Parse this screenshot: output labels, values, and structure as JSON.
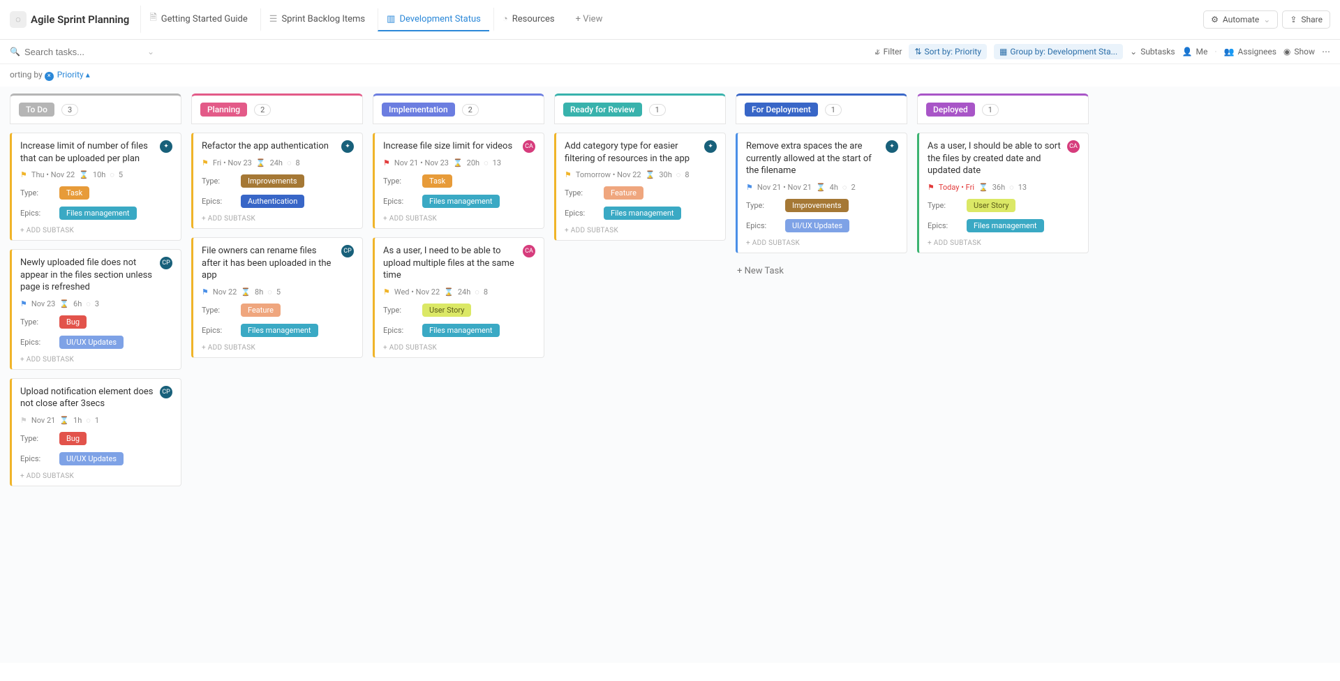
{
  "header": {
    "app_title": "Agile Sprint Planning",
    "tabs": [
      {
        "label": "Getting Started Guide",
        "active": false
      },
      {
        "label": "Sprint Backlog Items",
        "active": false
      },
      {
        "label": "Development Status",
        "active": true
      },
      {
        "label": "Resources",
        "active": false
      }
    ],
    "add_view": "+ View",
    "automate": "Automate",
    "share": "Share"
  },
  "toolbar": {
    "search_placeholder": "Search tasks...",
    "filter": "Filter",
    "sort": "Sort by: Priority",
    "group": "Group by: Development Sta...",
    "subtasks": "Subtasks",
    "me": "Me",
    "assignees": "Assignees",
    "show": "Show"
  },
  "sorting_row": {
    "prefix": "orting by",
    "value": "Priority"
  },
  "columns": [
    {
      "name": "To Do",
      "count": "3",
      "color": "#b5b5b5",
      "border_color": "#f0b429",
      "cards": [
        {
          "title": "Increase limit of number of files that can be uploaded per plan",
          "avatar": {
            "initials": "",
            "color": "teal",
            "sprint": true
          },
          "flag": "yellow",
          "dates": "Thu  •  Nov 22",
          "hours": "10h",
          "points": "5",
          "type": {
            "label": "Task",
            "cls": "task"
          },
          "epic": {
            "label": "Files management",
            "cls": "files"
          }
        },
        {
          "title": "Newly uploaded file does not appear in the files section unless page is refreshed",
          "avatar": {
            "initials": "CP",
            "color": "teal"
          },
          "flag": "blue",
          "dates": "Nov 23",
          "hours": "6h",
          "points": "3",
          "type": {
            "label": "Bug",
            "cls": "bug"
          },
          "epic": {
            "label": "UI/UX Updates",
            "cls": "uiux"
          }
        },
        {
          "title": "Upload notification element does not close after 3secs",
          "avatar": {
            "initials": "CP",
            "color": "teal"
          },
          "flag": "grey",
          "dates": "Nov 21",
          "hours": "1h",
          "points": "1",
          "type": {
            "label": "Bug",
            "cls": "bug"
          },
          "epic": {
            "label": "UI/UX Updates",
            "cls": "uiux"
          }
        }
      ]
    },
    {
      "name": "Planning",
      "count": "2",
      "color": "#e35a88",
      "border_color": "#f0b429",
      "cards": [
        {
          "title": "Refactor the app authentication",
          "avatar": {
            "initials": "",
            "color": "teal",
            "sprint": true
          },
          "flag": "yellow",
          "dates": "Fri  •  Nov 23",
          "hours": "24h",
          "points": "8",
          "type": {
            "label": "Improvements",
            "cls": "improve"
          },
          "epic": {
            "label": "Authentication",
            "cls": "auth"
          }
        },
        {
          "title": "File owners can rename files after it has been uploaded in the app",
          "avatar": {
            "initials": "CP",
            "color": "teal"
          },
          "flag": "blue",
          "dates": "Nov 22",
          "hours": "8h",
          "points": "5",
          "type": {
            "label": "Feature",
            "cls": "feature"
          },
          "epic": {
            "label": "Files management",
            "cls": "files"
          }
        }
      ]
    },
    {
      "name": "Implementation",
      "count": "2",
      "color": "#6b7de0",
      "border_color": "#f0b429",
      "cards": [
        {
          "title": "Increase file size limit for videos",
          "avatar": {
            "initials": "CA",
            "color": "pink"
          },
          "flag": "red",
          "dates": "Nov 21  •  Nov 23",
          "hours": "20h",
          "points": "13",
          "type": {
            "label": "Task",
            "cls": "task"
          },
          "epic": {
            "label": "Files management",
            "cls": "files"
          }
        },
        {
          "title": "As a user, I need to be able to upload multiple files at the same time",
          "avatar": {
            "initials": "CA",
            "color": "pink"
          },
          "flag": "yellow",
          "dates": "Wed  •  Nov 22",
          "hours": "24h",
          "points": "8",
          "type": {
            "label": "User Story",
            "cls": "userstory"
          },
          "epic": {
            "label": "Files management",
            "cls": "files"
          }
        }
      ]
    },
    {
      "name": "Ready for Review",
      "count": "1",
      "color": "#38b2ac",
      "border_color": "#f0b429",
      "cards": [
        {
          "title": "Add category type for easier filtering of resources in the app",
          "avatar": {
            "initials": "",
            "color": "teal",
            "sprint": true
          },
          "flag": "yellow",
          "dates": "Tomorrow  •  Nov 22",
          "hours": "30h",
          "points": "8",
          "type": {
            "label": "Feature",
            "cls": "feature"
          },
          "epic": {
            "label": "Files management",
            "cls": "files"
          }
        }
      ]
    },
    {
      "name": "For Deployment",
      "count": "1",
      "color": "#3866c7",
      "border_color": "#4a8fe7",
      "cards": [
        {
          "title": "Remove extra spaces the are currently allowed at the start of the filename",
          "avatar": {
            "initials": "",
            "color": "teal",
            "sprint": true
          },
          "flag": "blue",
          "dates": "Nov 21  •  Nov 21",
          "hours": "4h",
          "points": "2",
          "type": {
            "label": "Improvements",
            "cls": "improve"
          },
          "epic": {
            "label": "UI/UX Updates",
            "cls": "uiux"
          }
        }
      ],
      "new_task": "+ New Task"
    },
    {
      "name": "Deployed",
      "count": "1",
      "color": "#a855c7",
      "border_color": "#3cb371",
      "cards": [
        {
          "title": "As a user, I should be able to sort the files by created date and updated date",
          "avatar": {
            "initials": "CA",
            "color": "pink"
          },
          "flag": "red",
          "dates": "Today  •  Fri",
          "dates_color": "red",
          "hours": "36h",
          "points": "13",
          "type": {
            "label": "User Story",
            "cls": "userstory"
          },
          "epic": {
            "label": "Files management",
            "cls": "files"
          }
        }
      ]
    }
  ],
  "labels": {
    "type": "Type:",
    "epics": "Epics:",
    "add_subtask": "+ ADD SUBTASK"
  }
}
